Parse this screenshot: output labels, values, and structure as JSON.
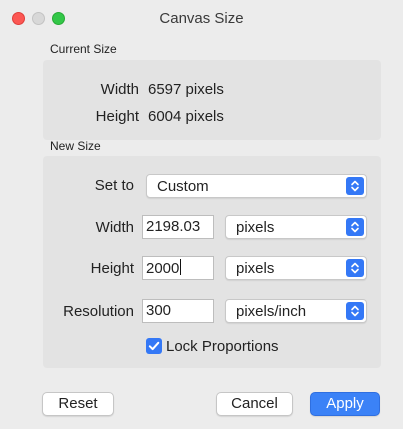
{
  "window": {
    "title": "Canvas Size"
  },
  "current_size": {
    "section_label": "Current Size",
    "width_label": "Width",
    "width_value": "6597 pixels",
    "height_label": "Height",
    "height_value": "6004 pixels"
  },
  "new_size": {
    "section_label": "New Size",
    "set_to_label": "Set to",
    "set_to_value": "Custom",
    "width_label": "Width",
    "width_value": "2198.03",
    "width_unit": "pixels",
    "height_label": "Height",
    "height_value": "2000",
    "height_unit": "pixels",
    "resolution_label": "Resolution",
    "resolution_value": "300",
    "resolution_unit": "pixels/inch",
    "lock_label": "Lock Proportions",
    "lock_checked": true
  },
  "buttons": {
    "reset": "Reset",
    "cancel": "Cancel",
    "apply": "Apply"
  },
  "colors": {
    "accent": "#3478f6",
    "close": "#fc5753",
    "maximize": "#33c748"
  },
  "icons": {
    "stepper": "up-down-chevron-icon",
    "checkmark": "checkmark-icon"
  }
}
